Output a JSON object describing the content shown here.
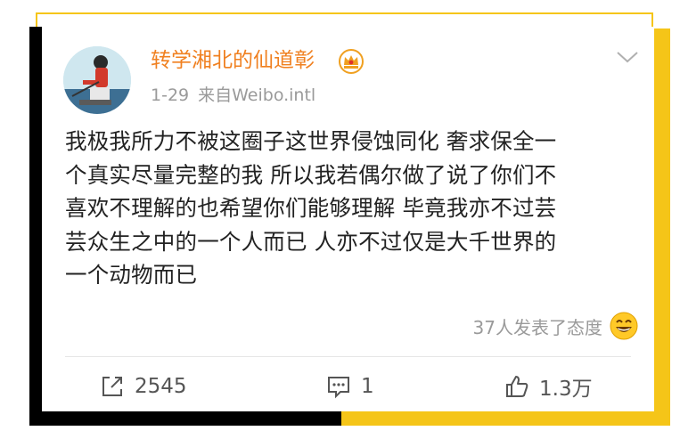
{
  "post": {
    "username": "转学湘北的仙道彰",
    "date": "1-29",
    "source": "来自Weibo.intl",
    "content_lines": [
      "我极我所力不被这圈子这世界侵蚀同化 奢求保全一",
      "个真实尽量完整的我 所以我若偶尔做了说了你们不",
      "喜欢不理解的也希望你们能够理解 毕竟我亦不过芸",
      "芸众生之中的一个人而已 人亦不过仅是大千世界的",
      "一个动物而已"
    ],
    "reactions_text": "37人发表了态度"
  },
  "actions": {
    "share_count": "2545",
    "comment_count": "1",
    "like_count": "1.3万"
  },
  "icons": {
    "crown": "crown-badge-icon",
    "more": "chevron-down-icon",
    "reaction": "smiley-icon",
    "share": "share-icon",
    "comment": "comment-icon",
    "like": "thumbs-up-icon"
  },
  "colors": {
    "username": "#f08020",
    "accent_yellow": "#f5c518",
    "meta_gray": "#9a9a9a"
  }
}
